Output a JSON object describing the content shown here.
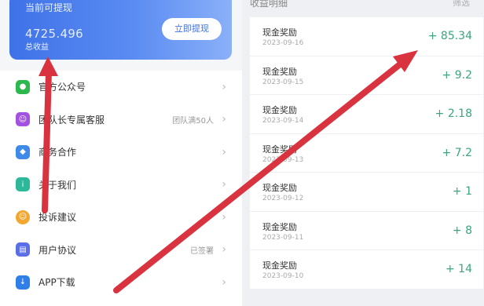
{
  "card": {
    "label_current": "当前可提现",
    "amount": "4725.496",
    "label_total": "总收益",
    "withdraw_button": "立即提现"
  },
  "menu": [
    {
      "label": "官方公众号",
      "icon": "wechat-icon",
      "color": "#2db84d",
      "extra": ""
    },
    {
      "label": "团队长专属客服",
      "icon": "service-icon",
      "color": "#a251e0",
      "extra": "团队满50人"
    },
    {
      "label": "商务合作",
      "icon": "business-icon",
      "color": "#3f8ae8",
      "extra": ""
    },
    {
      "label": "关于我们",
      "icon": "about-icon",
      "color": "#2db89a",
      "extra": ""
    },
    {
      "label": "投诉建议",
      "icon": "feedback-icon",
      "color": "#f3a730",
      "extra": ""
    },
    {
      "label": "用户协议",
      "icon": "agreement-icon",
      "color": "#5a6ee8",
      "extra": "已签署"
    },
    {
      "label": "APP下载",
      "icon": "download-icon",
      "color": "#2f7fe8",
      "extra": ""
    }
  ],
  "earnings": {
    "header": "收益明细",
    "filter": "筛选",
    "rows": [
      {
        "title": "现金奖励",
        "date": "2023-09-16",
        "value": "+ 85.34"
      },
      {
        "title": "现金奖励",
        "date": "2023-09-15",
        "value": "+ 9.2"
      },
      {
        "title": "现金奖励",
        "date": "2023-09-14",
        "value": "+ 2.18"
      },
      {
        "title": "现金奖励",
        "date": "2023-09-13",
        "value": "+ 7.2"
      },
      {
        "title": "现金奖励",
        "date": "2023-09-12",
        "value": "+ 1"
      },
      {
        "title": "现金奖励",
        "date": "2023-09-11",
        "value": "+ 8"
      },
      {
        "title": "现金奖励",
        "date": "2023-09-10",
        "value": "+ 14"
      }
    ]
  },
  "colors": {
    "accent": "#3f72e8",
    "positive": "#3aa67a",
    "arrow": "#d9333f"
  }
}
